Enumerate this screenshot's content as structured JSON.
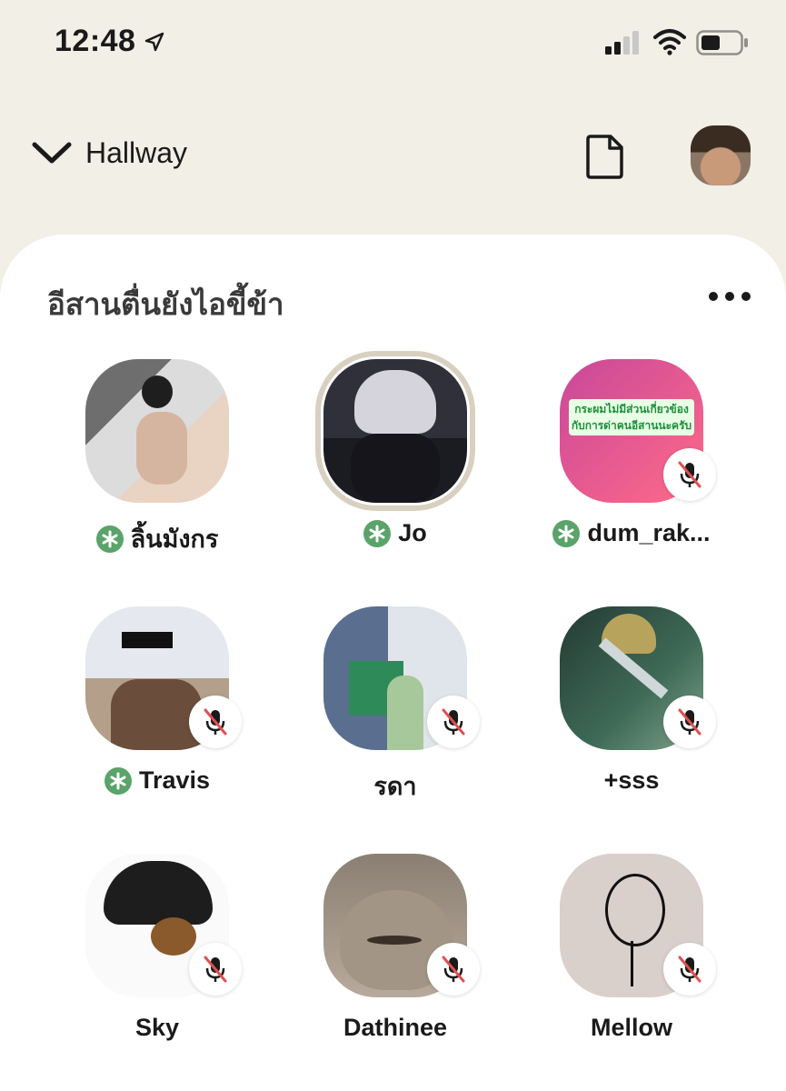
{
  "status_bar": {
    "time": "12:48"
  },
  "header": {
    "back_label": "Hallway"
  },
  "room": {
    "title": "อีสานตื่นยังไอขี้ข้า"
  },
  "speakers": [
    {
      "name": "ลิ้นมังกร",
      "moderator": true,
      "muted": false,
      "active": false
    },
    {
      "name": "Jo",
      "moderator": true,
      "muted": false,
      "active": true
    },
    {
      "name": "dum_rak...",
      "moderator": true,
      "muted": true,
      "active": false,
      "avatar_text": "กระผมไม่มีส่วนเกี่ยวข้องกับการด่าคนอีสานนะครับ"
    },
    {
      "name": "Travis",
      "moderator": true,
      "muted": true,
      "active": false
    },
    {
      "name": "รดา",
      "moderator": false,
      "muted": true,
      "active": false
    },
    {
      "name": "+sss",
      "moderator": false,
      "muted": true,
      "active": false
    },
    {
      "name": "Sky",
      "moderator": false,
      "muted": true,
      "active": false
    },
    {
      "name": "Dathinee",
      "moderator": false,
      "muted": true,
      "active": false
    },
    {
      "name": "Mellow",
      "moderator": false,
      "muted": true,
      "active": false
    }
  ],
  "colors": {
    "background": "#f1efe6",
    "card": "#ffffff",
    "moderator_badge": "#5aa36a",
    "mute_slash": "#e05050"
  }
}
